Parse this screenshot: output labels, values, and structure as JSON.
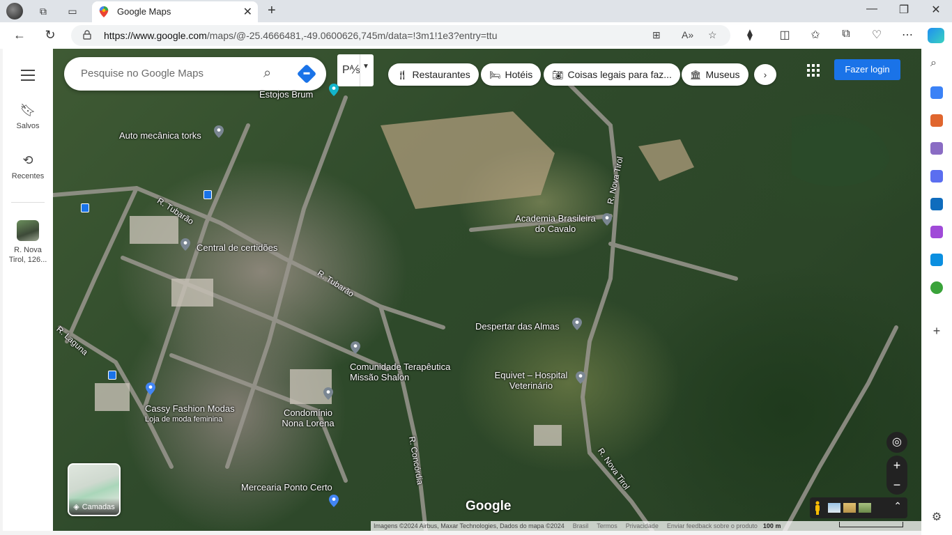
{
  "browser": {
    "tab_title": "Google Maps",
    "url_domain": "https://www.google.com",
    "url_path": "/maps/@-25.4666481,-49.0600626,745m/data=!3m1!1e3?entry=ttu"
  },
  "maps": {
    "search_placeholder": "Pesquise no Google Maps",
    "rail": {
      "saved_label": "Salvos",
      "recents_label": "Recentes",
      "recent_place": "R. Nova Tirol, 126..."
    },
    "chips": [
      "Restaurantes",
      "Hotéis",
      "Coisas legais para faz...",
      "Museus"
    ],
    "login_label": "Fazer login",
    "layers_label": "Camadas",
    "logo": "Google",
    "places": [
      {
        "name": "Estojos Brum"
      },
      {
        "name": "Auto mecânica torks"
      },
      {
        "name": "Central de certidões"
      },
      {
        "name": "Academia Brasileira do Cavalo"
      },
      {
        "name": "Despertar das Almas"
      },
      {
        "name": "Comunidade Terapêutica Missão Shalon"
      },
      {
        "name": "Equivet – Hospital Veterinário"
      },
      {
        "name": "Cassy Fashion Modas",
        "subtitle": "Loja de moda feminina"
      },
      {
        "name": "Condomínio Nona Lorena"
      },
      {
        "name": "Mercearia Ponto Certo"
      }
    ],
    "roads": [
      "R. Tubarão",
      "R. Tubarão",
      "R. Laguna",
      "R. Nova Tirol",
      "R. Nova Tirol",
      "R. Concórdia"
    ],
    "footer": {
      "imagery": "Imagens ©2024 Airbus, Maxar Technologies, Dados do mapa ©2024",
      "country": "Brasil",
      "terms": "Termos",
      "privacy": "Privacidade",
      "feedback": "Enviar feedback sobre o produto",
      "scale": "100 m"
    }
  },
  "colors": {
    "accent": "#1a73e8",
    "pin_grey": "#7a8692",
    "pin_blue": "#4285f4",
    "pin_teal": "#12b5cb"
  }
}
